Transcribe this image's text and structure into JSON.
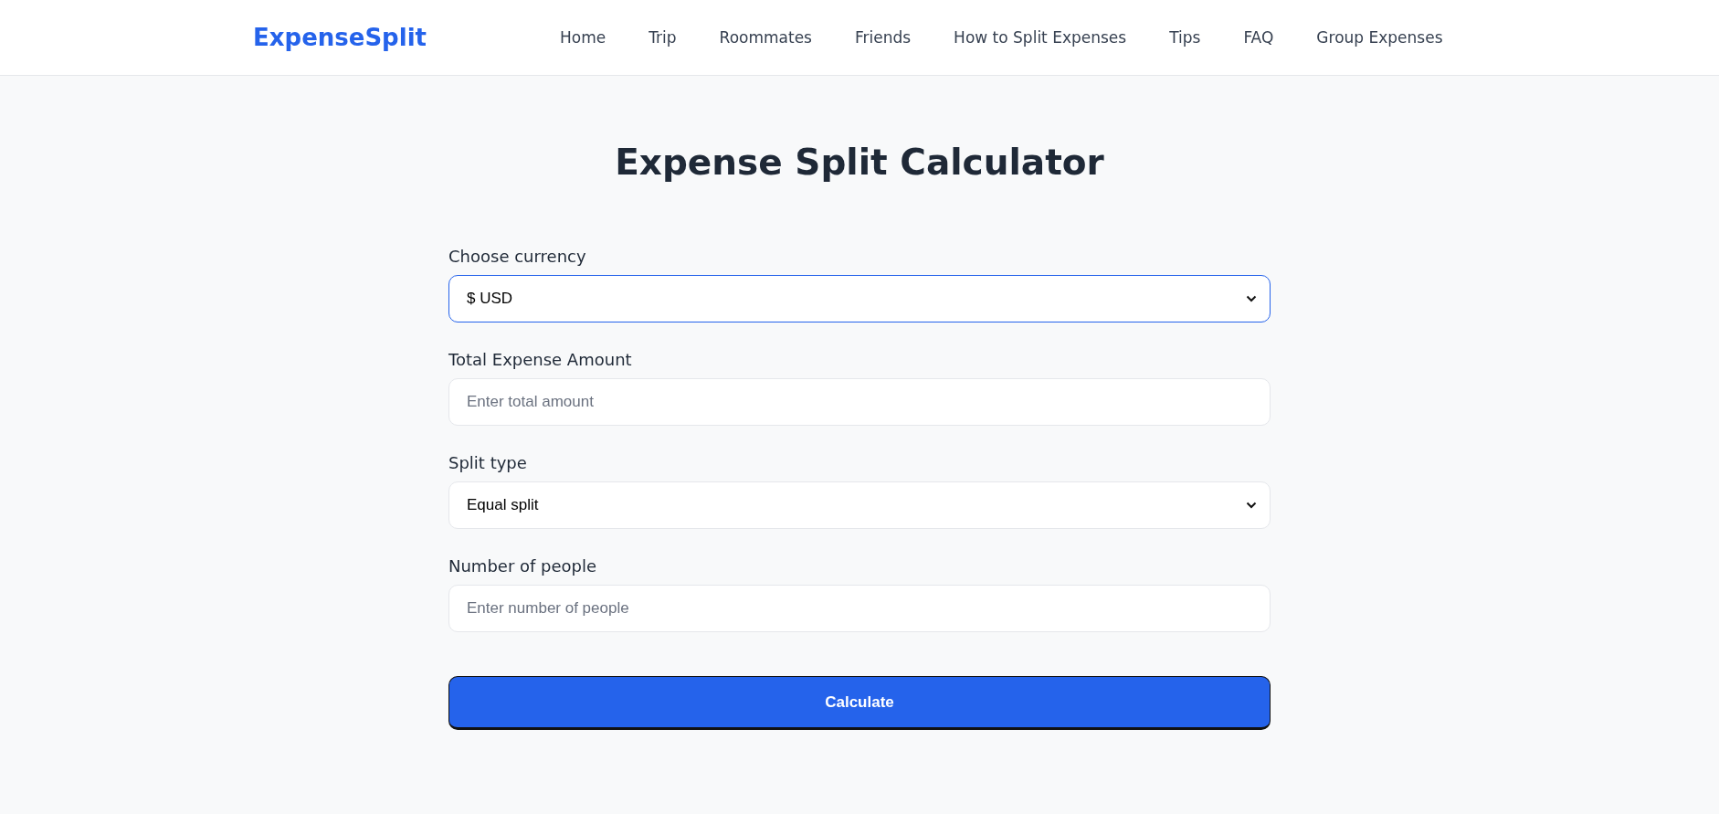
{
  "header": {
    "logo": "ExpenseSplit",
    "nav": [
      {
        "label": "Home"
      },
      {
        "label": "Trip"
      },
      {
        "label": "Roommates"
      },
      {
        "label": "Friends"
      },
      {
        "label": "How to Split Expenses"
      },
      {
        "label": "Tips"
      },
      {
        "label": "FAQ"
      },
      {
        "label": "Group Expenses"
      }
    ]
  },
  "title": "Expense Split Calculator",
  "fields": [
    {
      "kind": "select",
      "label": "Choose currency",
      "value": "$ USD",
      "focused": true
    },
    {
      "kind": "input",
      "label": "Total Expense Amount",
      "placeholder": "Enter total amount",
      "focused": false
    },
    {
      "kind": "select",
      "label": "Split type",
      "value": "Equal split",
      "focused": false
    },
    {
      "kind": "input",
      "label": "Number of people",
      "placeholder": "Enter number of people",
      "focused": false
    }
  ],
  "button": "Calculate"
}
